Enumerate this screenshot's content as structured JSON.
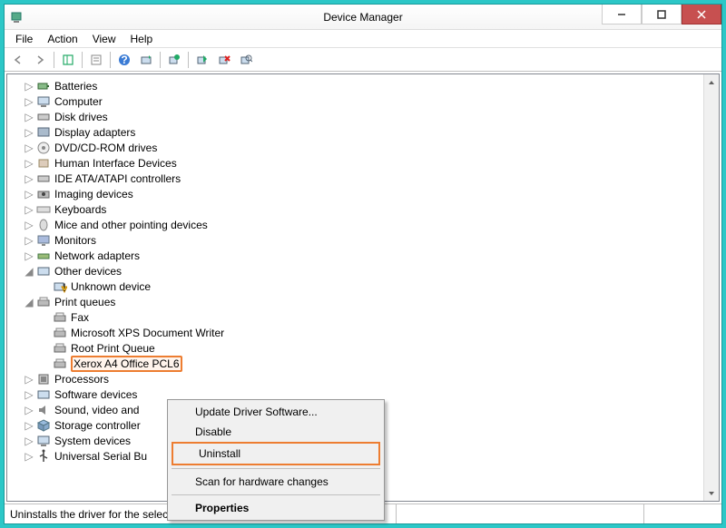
{
  "window": {
    "title": "Device Manager"
  },
  "menubar": {
    "file": "File",
    "action": "Action",
    "view": "View",
    "help": "Help"
  },
  "tree": {
    "batteries": "Batteries",
    "computer": "Computer",
    "disk_drives": "Disk drives",
    "display_adapters": "Display adapters",
    "dvd": "DVD/CD-ROM drives",
    "hid": "Human Interface Devices",
    "ide": "IDE ATA/ATAPI controllers",
    "imaging": "Imaging devices",
    "keyboards": "Keyboards",
    "mice": "Mice and other pointing devices",
    "monitors": "Monitors",
    "network": "Network adapters",
    "other": "Other devices",
    "unknown": "Unknown device",
    "print_queues": "Print queues",
    "fax": "Fax",
    "xps": "Microsoft XPS Document Writer",
    "root_print": "Root Print Queue",
    "xerox": "Xerox A4 Office PCL6",
    "processors": "Processors",
    "software": "Software devices",
    "sound": "Sound, video and",
    "storage": "Storage controller",
    "system": "System devices",
    "usb": "Universal Serial Bu"
  },
  "context_menu": {
    "update": "Update Driver Software...",
    "disable": "Disable",
    "uninstall": "Uninstall",
    "scan": "Scan for hardware changes",
    "properties": "Properties"
  },
  "statusbar": {
    "text": "Uninstalls the driver for the selected device."
  }
}
